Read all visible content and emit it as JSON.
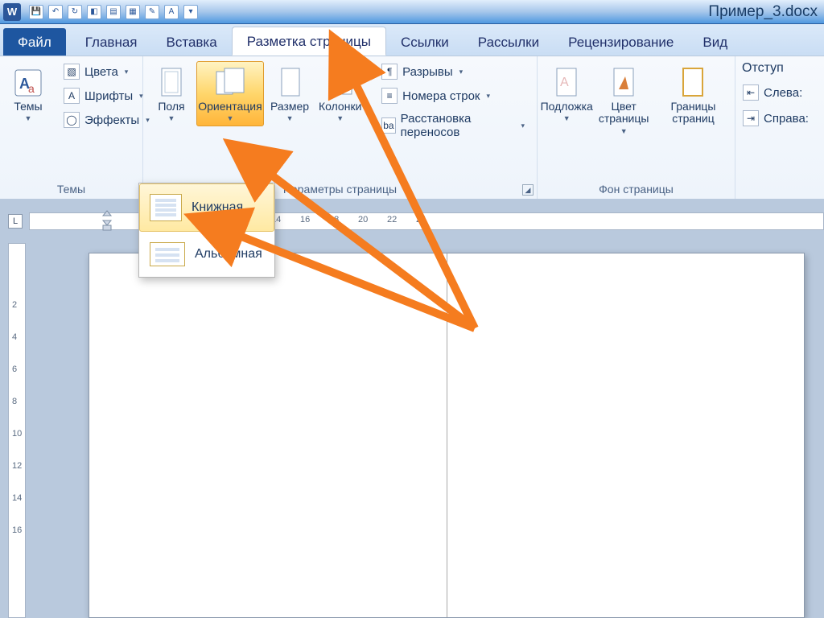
{
  "title": "Пример_3.docx",
  "tabs": {
    "file": "Файл",
    "home": "Главная",
    "insert": "Вставка",
    "layout": "Разметка страницы",
    "references": "Ссылки",
    "mailings": "Рассылки",
    "review": "Рецензирование",
    "view": "Вид"
  },
  "ribbon": {
    "themes": {
      "group_label": "Темы",
      "themes_btn": "Темы",
      "colors": "Цвета",
      "fonts": "Шрифты",
      "effects": "Эффекты"
    },
    "page_setup": {
      "group_label": "Параметры страницы",
      "margins": "Поля",
      "orientation": "Ориентация",
      "size": "Размер",
      "columns": "Колонки",
      "breaks": "Разрывы",
      "line_numbers": "Номера строк",
      "hyphenation": "Расстановка переносов"
    },
    "page_bg": {
      "group_label": "Фон страницы",
      "watermark": "Подложка",
      "page_color": "Цвет страницы",
      "page_borders": "Границы страниц"
    },
    "paragraph": {
      "group_label": "Отступ",
      "left": "Слева:",
      "right": "Справа:"
    }
  },
  "orientation_menu": {
    "portrait": "Книжная",
    "landscape": "Альбомная"
  },
  "ruler": {
    "ticks": [
      "14",
      "16",
      "18",
      "20",
      "22",
      "24"
    ]
  },
  "vruler": {
    "ticks": [
      "2",
      "4",
      "6",
      "8",
      "10",
      "12",
      "14",
      "16"
    ]
  },
  "annotation_color": "#f57c1f"
}
